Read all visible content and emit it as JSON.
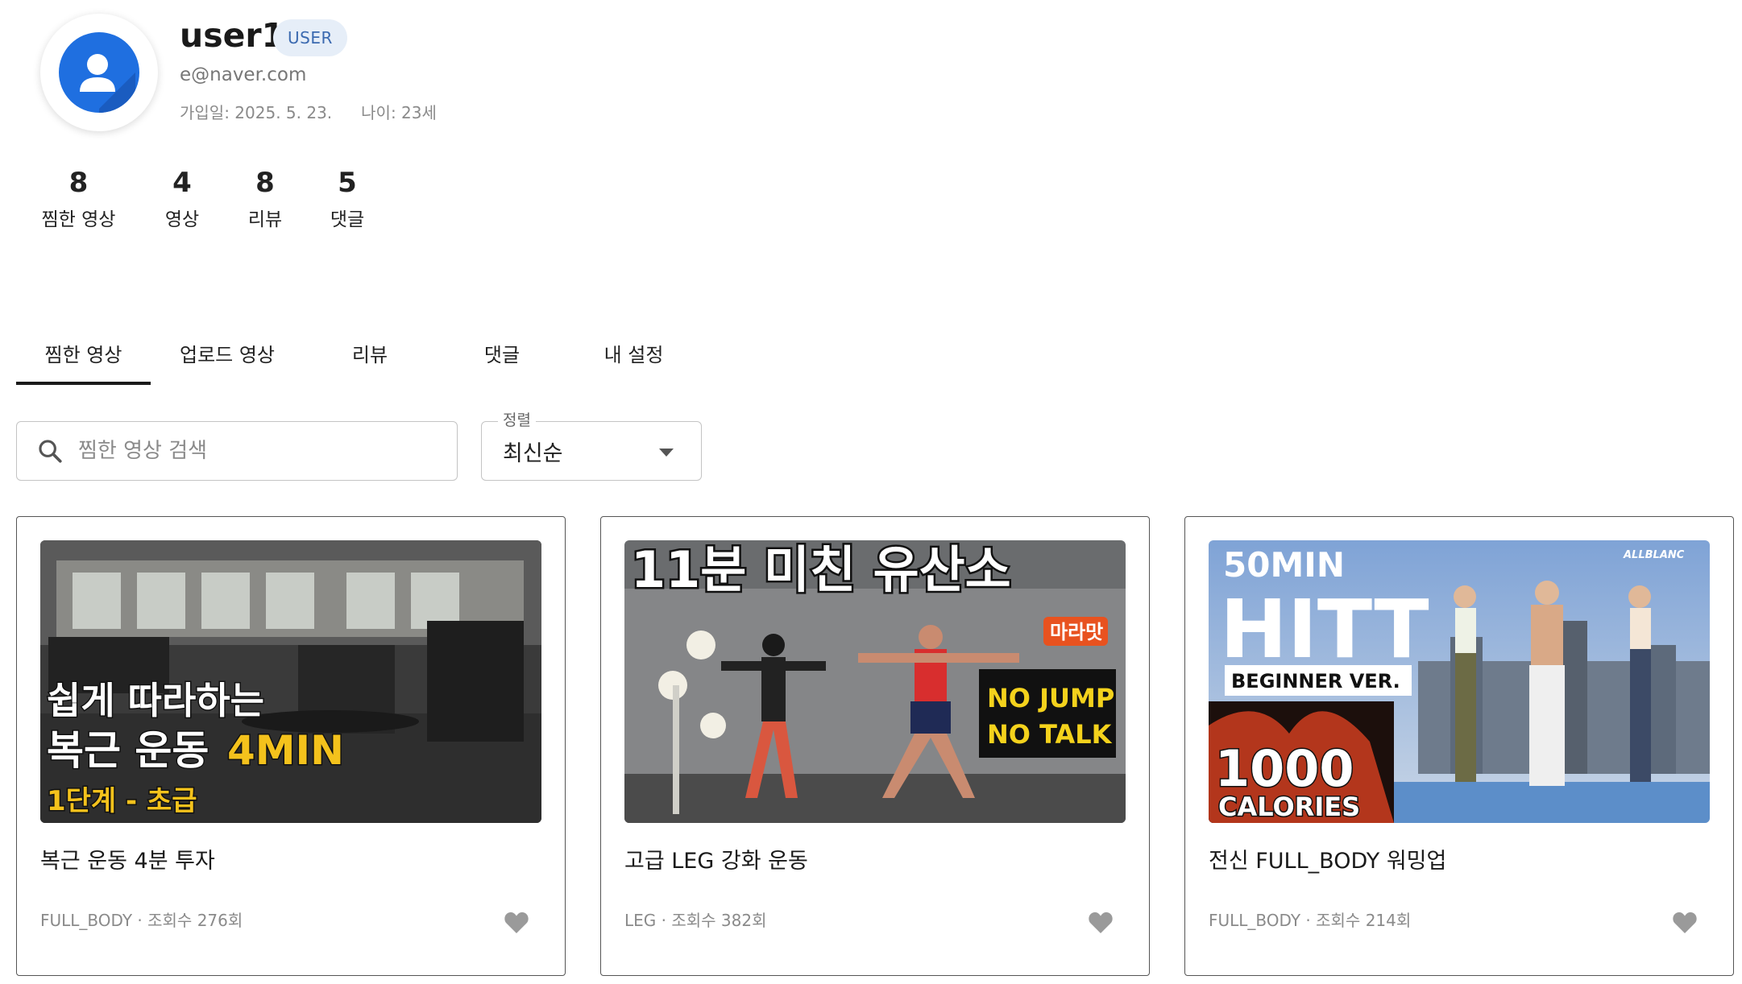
{
  "profile": {
    "username": "user1",
    "role": "USER",
    "email": "e@naver.com",
    "joined": "가입일: 2025. 5. 23.",
    "age": "나이: 23세",
    "avatar_icon": "user-icon"
  },
  "stats": [
    {
      "value": "8",
      "label": "찜한 영상"
    },
    {
      "value": "4",
      "label": "영상"
    },
    {
      "value": "8",
      "label": "리뷰"
    },
    {
      "value": "5",
      "label": "댓글"
    }
  ],
  "tabs": [
    {
      "label": "찜한 영상",
      "active": true
    },
    {
      "label": "업로드 영상",
      "active": false
    },
    {
      "label": "리뷰",
      "active": false
    },
    {
      "label": "댓글",
      "active": false
    },
    {
      "label": "내 설정",
      "active": false
    }
  ],
  "search": {
    "placeholder": "찜한 영상 검색",
    "value": ""
  },
  "sort": {
    "label": "정렬",
    "value": "최신순"
  },
  "cards": [
    {
      "title": "복근 운동 4분 투자",
      "meta": "FULL_BODY · 조회수 276회",
      "thumb_text": [
        "쉽게 따라하는",
        "복근 운동",
        "4MIN",
        "1단계 - 초급"
      ]
    },
    {
      "title": "고급 LEG 강화 운동",
      "meta": "LEG · 조회수 382회",
      "thumb_text": [
        "11분 미친 유산소",
        "마라맛",
        "NO JUMP",
        "NO TALK"
      ]
    },
    {
      "title": "전신 FULL_BODY 워밍업",
      "meta": "FULL_BODY · 조회수 214회",
      "thumb_text": [
        "50MIN",
        "HITT",
        "BEGINNER VER.",
        "1000",
        "CALORIES",
        "ALLBLANC"
      ]
    }
  ],
  "colors": {
    "accent": "#1f6fe0",
    "badge_bg": "#e6eef8",
    "badge_text": "#3b6ab0",
    "heart": "#9a9a9a"
  }
}
